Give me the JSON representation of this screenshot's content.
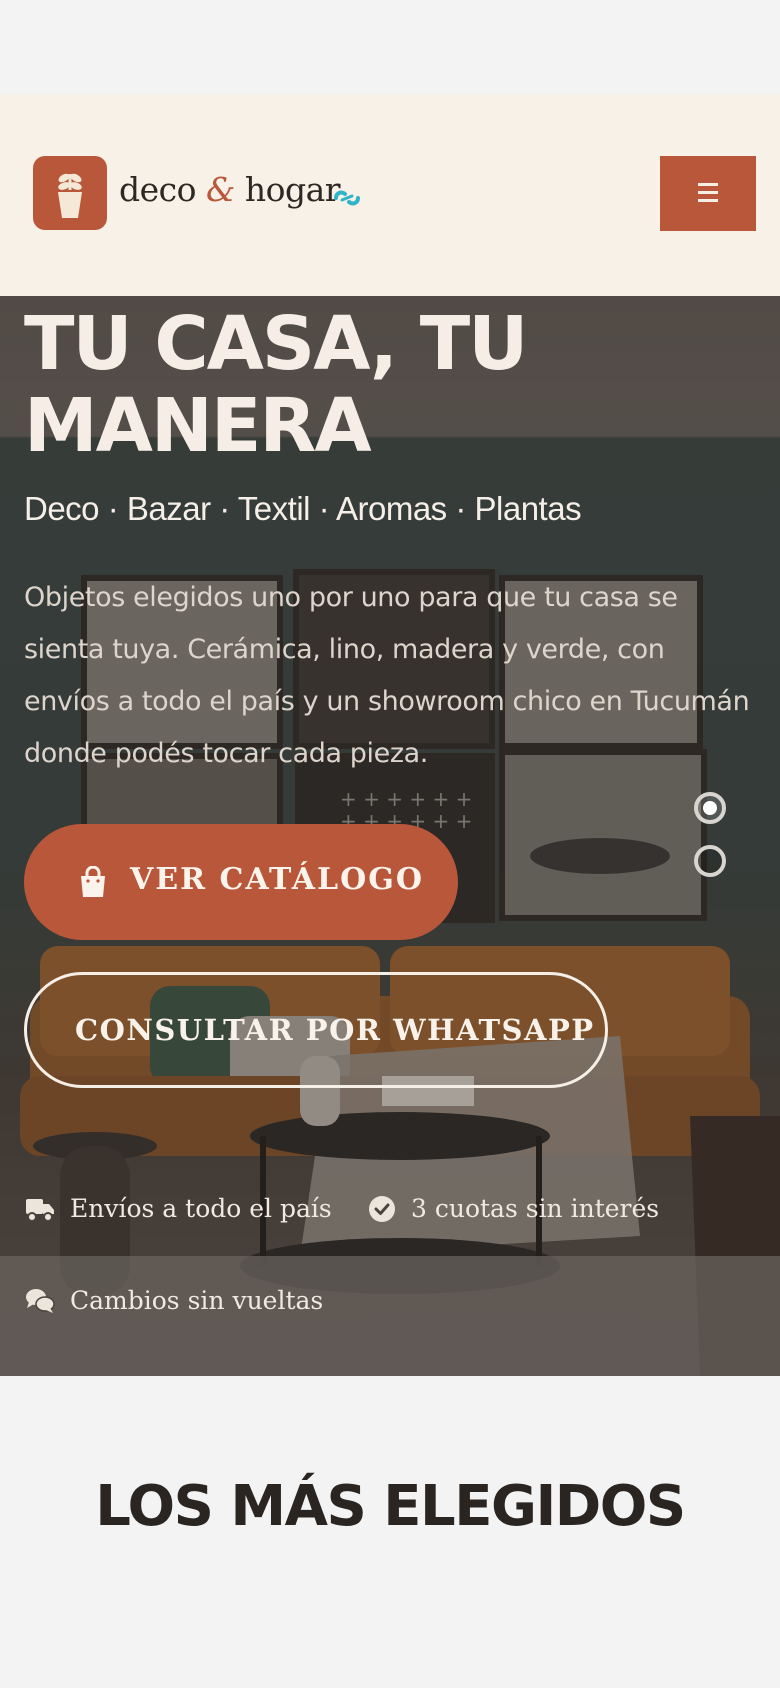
{
  "brand": {
    "name_part1": "deco",
    "ampersand": "&",
    "name_part2": "hogar",
    "accent_color": "#b9573a",
    "link_icon": "link-icon"
  },
  "header": {
    "menu_icon": "hamburger-icon"
  },
  "hero": {
    "title": "TU CASA, TU\nMANERA",
    "subtitle": "Deco · Bazar · Textil · Aromas · Plantas",
    "description": "Objetos elegidos uno por uno para que tu casa se sienta tuya. Cerámica, lino, madera y verde, con envíos a todo el país y un showroom chico en Tucumán donde podés tocar cada pieza.",
    "primary_button": {
      "label": "VER CATÁLOGO",
      "icon": "shopping-bag-icon"
    },
    "secondary_button": {
      "label": "CONSULTAR POR WHATSAPP"
    },
    "slider": {
      "total": 2,
      "active": 1
    },
    "features": [
      {
        "icon": "truck-icon",
        "text": "Envíos a todo el país"
      },
      {
        "icon": "check-circle-icon",
        "text": "3 cuotas sin interés"
      },
      {
        "icon": "chat-bubbles-icon",
        "text": "Cambios sin vueltas"
      }
    ]
  },
  "section": {
    "title": "LOS MÁS ELEGIDOS"
  }
}
